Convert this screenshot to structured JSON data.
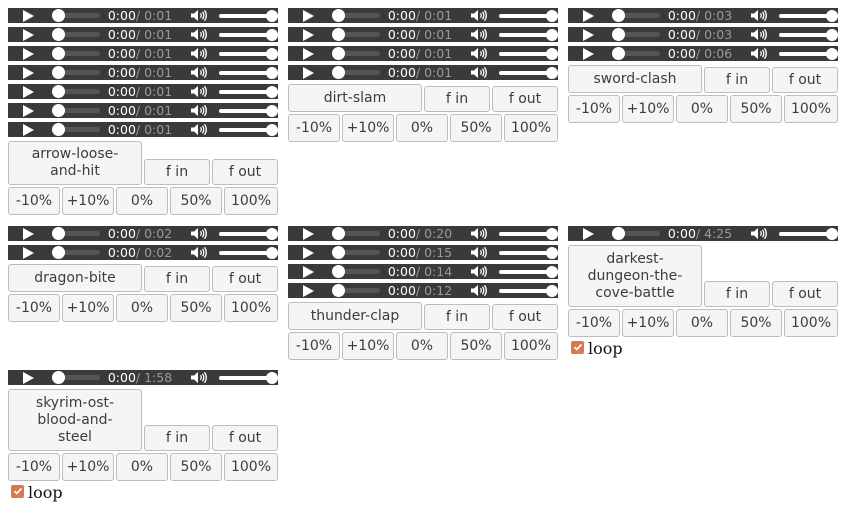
{
  "labels": {
    "fade_in": "f in",
    "fade_out": "f out",
    "minus10": "-10%",
    "plus10": "+10%",
    "zero": "0%",
    "fifty": "50%",
    "hundred": "100%",
    "loop": "loop",
    "time_sep": "/ "
  },
  "groups": [
    {
      "name": "arrow-loose-\nand-hit",
      "players": [
        {
          "current": "0:00",
          "duration": "0:01"
        },
        {
          "current": "0:00",
          "duration": "0:01"
        },
        {
          "current": "0:00",
          "duration": "0:01"
        },
        {
          "current": "0:00",
          "duration": "0:01"
        },
        {
          "current": "0:00",
          "duration": "0:01"
        },
        {
          "current": "0:00",
          "duration": "0:01"
        },
        {
          "current": "0:00",
          "duration": "0:01"
        }
      ]
    },
    {
      "name": "dirt-slam",
      "players": [
        {
          "current": "0:00",
          "duration": "0:01"
        },
        {
          "current": "0:00",
          "duration": "0:01"
        },
        {
          "current": "0:00",
          "duration": "0:01"
        },
        {
          "current": "0:00",
          "duration": "0:01"
        }
      ]
    },
    {
      "name": "sword-clash",
      "players": [
        {
          "current": "0:00",
          "duration": "0:03"
        },
        {
          "current": "0:00",
          "duration": "0:03"
        },
        {
          "current": "0:00",
          "duration": "0:06"
        }
      ]
    },
    {
      "name": "dragon-bite",
      "players": [
        {
          "current": "0:00",
          "duration": "0:02"
        },
        {
          "current": "0:00",
          "duration": "0:02"
        }
      ]
    },
    {
      "name": "thunder-clap",
      "players": [
        {
          "current": "0:00",
          "duration": "0:20"
        },
        {
          "current": "0:00",
          "duration": "0:15"
        },
        {
          "current": "0:00",
          "duration": "0:14"
        },
        {
          "current": "0:00",
          "duration": "0:12"
        }
      ]
    },
    {
      "name": "darkest-\ndungeon-the-\ncove-battle",
      "players": [
        {
          "current": "0:00",
          "duration": "4:25"
        }
      ],
      "loop": true
    },
    {
      "name": "skyrim-ost-\nblood-and-\nsteel",
      "players": [
        {
          "current": "0:00",
          "duration": "1:58"
        }
      ],
      "loop": true
    }
  ],
  "colors": {
    "player_bg": "#3a3a3a",
    "button_bg": "#f5f5f4",
    "button_border": "#bdbdbd",
    "checkbox": "#e0764a"
  },
  "icons": [
    "play-icon",
    "volume-icon",
    "check-icon"
  ]
}
